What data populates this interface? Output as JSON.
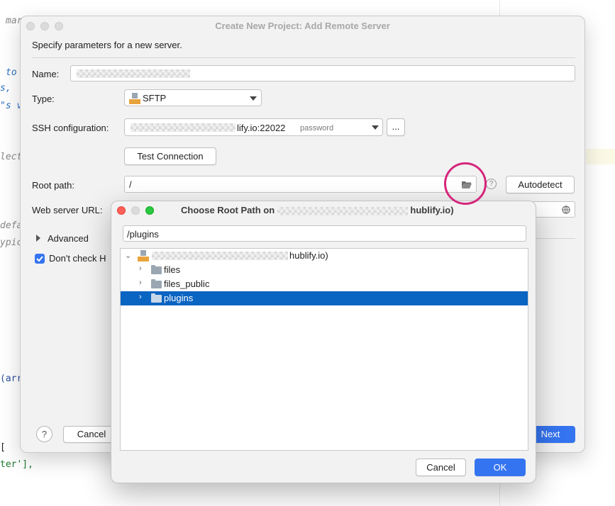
{
  "editor": {
    "fragments": [
      "mar",
      "to",
      "s, ",
      "\"s v",
      "lect",
      "defa",
      "ypic",
      "(arr",
      "[",
      "ter'],"
    ]
  },
  "main_dialog": {
    "title": "Create New Project: Add Remote Server",
    "subtitle": "Specify parameters for a new server.",
    "name_label": "Name:",
    "type_label": "Type:",
    "type_value": "SFTP",
    "ssh_label": "SSH configuration:",
    "ssh_value_suffix": "lify.io:22022",
    "ssh_auth": "password",
    "ssh_more": "...",
    "test_connection": "Test Connection",
    "root_path_label": "Root path:",
    "root_path_value": "/",
    "help_glyph": "?",
    "autodetect": "Autodetect",
    "web_url_label": "Web server URL:",
    "advanced_label": "Advanced",
    "dont_check_label": "Don't check H",
    "cancel": "Cancel",
    "next": "Next"
  },
  "sub_dialog": {
    "title_prefix": "Choose Root Path on",
    "title_suffix": "hublify.io)",
    "path_value": "/plugins",
    "root_label_suffix": "hublify.io)",
    "items": [
      {
        "label": "files"
      },
      {
        "label": "files_public"
      },
      {
        "label": "plugins"
      }
    ],
    "cancel": "Cancel",
    "ok": "OK"
  },
  "colors": {
    "accent": "#3574f0",
    "selection": "#0a64c2",
    "highlight_circle": "#d6267c",
    "traffic_close": "#fe5f57",
    "traffic_min": "#febc2e",
    "traffic_max": "#28c840"
  }
}
